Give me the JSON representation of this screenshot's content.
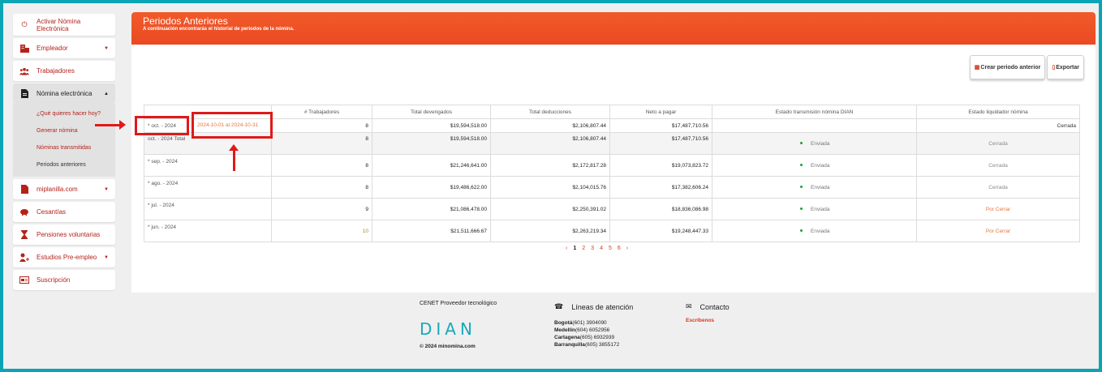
{
  "sidebar": {
    "items": [
      {
        "label": "Activar Nómina Electrónica",
        "icon": "power-icon"
      },
      {
        "label": "Empleador",
        "icon": "building-icon"
      },
      {
        "label": "Trabajadores",
        "icon": "users-icon"
      },
      {
        "label": "Nómina electrónica",
        "icon": "document-icon"
      },
      {
        "label": "miplanilla.com",
        "icon": "file-icon"
      },
      {
        "label": "Cesantías",
        "icon": "piggy-bank-icon"
      },
      {
        "label": "Pensiones voluntarias",
        "icon": "hourglass-icon"
      },
      {
        "label": "Estudios Pre-empleo",
        "icon": "user-plus-icon"
      },
      {
        "label": "Suscripción",
        "icon": "card-icon"
      }
    ],
    "subitems": [
      {
        "label": "¿Qué quieres hacer hoy?"
      },
      {
        "label": "Generar nómina"
      },
      {
        "label": "Nóminas transmitidas"
      },
      {
        "label": "Periodos anteriores"
      }
    ]
  },
  "banner": {
    "title": "Periodos Anteriores",
    "subtitle": "A continuación encontrarás el historial de periodos de la nómina."
  },
  "toolbar": {
    "create_label": "Crear periodo anterior",
    "export_label": "Exportar"
  },
  "table": {
    "headers": [
      "",
      "",
      "# Trabajadores",
      "Total devengados",
      "Total deducciones",
      "Neto a pagar",
      "Estado transmisión nómina DIAN",
      "Estado liquidador nómina"
    ],
    "rows": [
      {
        "period": "* oct. - 2024",
        "range": "2024-10-01 al 2024-10-31",
        "workers": "8",
        "devengados": "$19,594,518.00",
        "deducciones": "$2,106,807.44",
        "neto": "$17,487,710.56",
        "dian": "",
        "estado": "Cerrada"
      },
      {
        "period": "oct. - 2024 Total",
        "range": "",
        "workers": "8",
        "devengados": "$19,594,518.00",
        "deducciones": "$2,106,807.44",
        "neto": "$17,487,710.56",
        "dian": "Enviada",
        "estado": "Cerrada"
      },
      {
        "period": "* sep. - 2024",
        "range": "",
        "workers": "8",
        "devengados": "$21,246,641.00",
        "deducciones": "$2,172,817.28",
        "neto": "$19,073,823.72",
        "dian": "Enviada",
        "estado": "Cerrada"
      },
      {
        "period": "* ago. - 2024",
        "range": "",
        "workers": "8",
        "devengados": "$19,486,622.00",
        "deducciones": "$2,104,015.76",
        "neto": "$17,382,606.24",
        "dian": "Enviada",
        "estado": "Cerrada"
      },
      {
        "period": "* jul. - 2024",
        "range": "",
        "workers": "9",
        "devengados": "$21,086,478.00",
        "deducciones": "$2,250,391.02",
        "neto": "$18,836,086.98",
        "dian": "Enviada",
        "estado": "Por Cerrar"
      },
      {
        "period": "* jun. - 2024",
        "range": "",
        "workers": "10",
        "devengados": "$21,511,666.67",
        "deducciones": "$2,263,219.34",
        "neto": "$19,248,447.33",
        "dian": "Enviada",
        "estado": "Por Cerrar"
      }
    ]
  },
  "pager": {
    "prev": "‹",
    "pages": [
      "1",
      "2",
      "3",
      "4",
      "5",
      "6"
    ],
    "next": "›",
    "current": "1"
  },
  "footer": {
    "provider": "CENET Proveedor tecnológico",
    "logo_text": "DIAN",
    "copyright": "© 2024 minomina.com",
    "lines_title": "Líneas de atención",
    "lines": [
      {
        "city": "Bogotá",
        "phone": "(601) 3904090"
      },
      {
        "city": "Medellín",
        "phone": "(604) 6052956"
      },
      {
        "city": "Cartagena",
        "phone": "(605) 6932939"
      },
      {
        "city": "Barranquilla",
        "phone": "(605) 3855172"
      }
    ],
    "contact_title": "Contacto",
    "contact_link": "Escríbenos"
  },
  "colors": {
    "accent": "#f25a2a",
    "link": "#b5221b",
    "frame": "#0aa4b5",
    "annotation": "#e01919"
  }
}
